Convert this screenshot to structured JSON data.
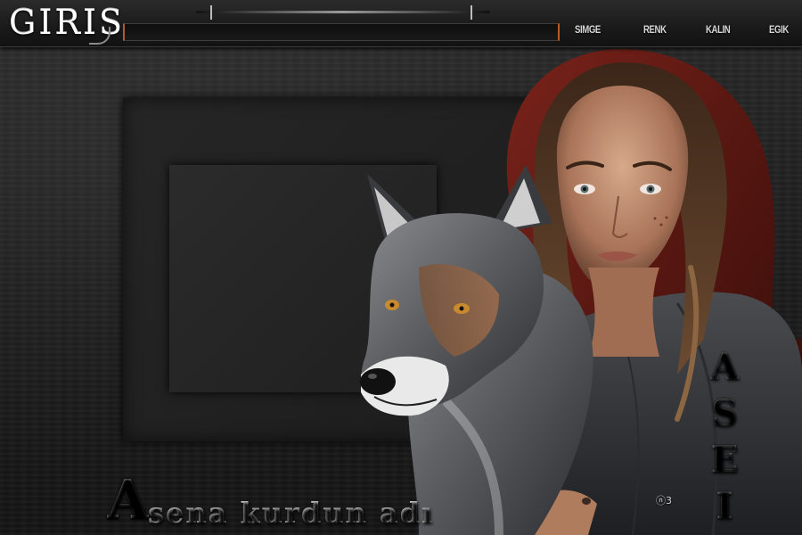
{
  "header": {
    "logo_text": "GIRIS",
    "input_value": "",
    "buttons": {
      "simge": "SIMGE",
      "renk": "RENK",
      "kalin": "KALIN",
      "egik": "EGIK"
    }
  },
  "caption": {
    "initial": "A",
    "rest": "sena kurdun adı"
  },
  "side_letters": [
    "A",
    "S",
    "E",
    "I"
  ],
  "copyright": "ⓝ3",
  "colors": {
    "input_border_accent": "#b55a2a",
    "hood_red": "#6e1c14"
  }
}
